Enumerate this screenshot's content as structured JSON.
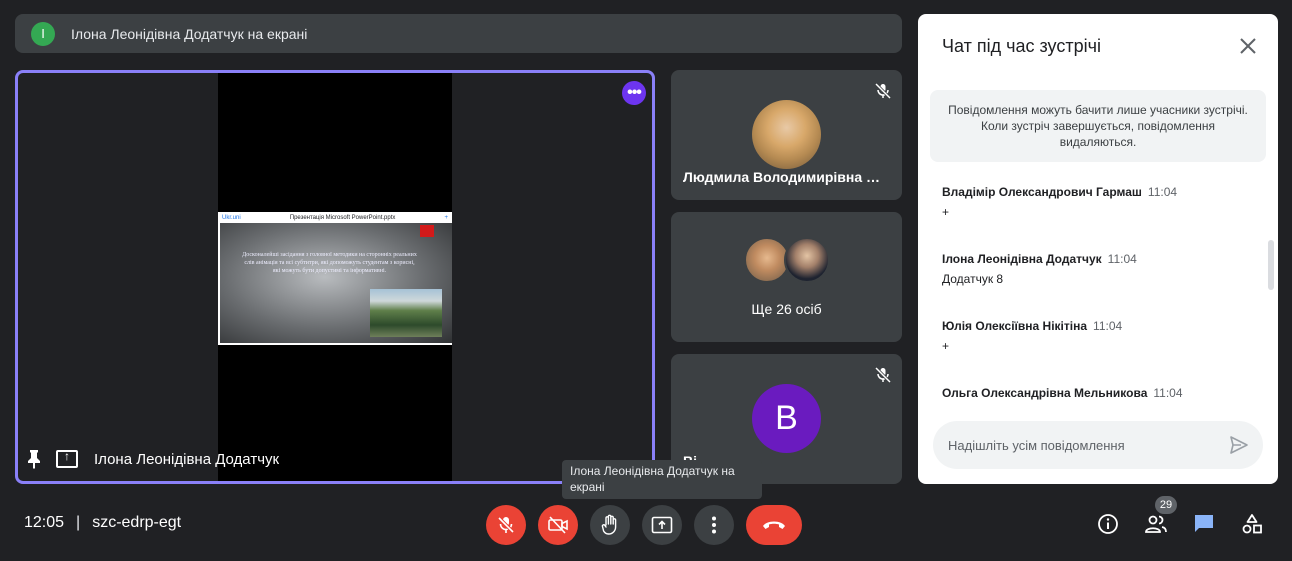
{
  "banner": {
    "avatar_letter": "І",
    "text": "Ілона Леонідівна Додатчук на екрані",
    "avatar_color": "#34a853"
  },
  "main_tile": {
    "presenter_name": "Ілона Леонідівна Додатчук",
    "slide": {
      "window_title": "Презентація Microsoft PowerPoint.pptx",
      "left_label": "Ukr.uni",
      "right_label": "+",
      "text": "Досконалейші засідання з головної методики на сторонніх реальних слів анімація та всі субтитри, які допоможуть студентам з корисні, які можуть бути допустимі та інформативні."
    },
    "accent_color": "#8a80f8"
  },
  "side_tiles": [
    {
      "name": "Людмила Володимирівна Б…",
      "muted": true
    },
    {
      "more_label": "Ще 26 осіб"
    },
    {
      "avatar_letter": "В",
      "name": "Ві…",
      "muted": true,
      "avatar_color": "#6a1bbf"
    }
  ],
  "tooltip": "Ілона Леонідівна Додатчук на екрані",
  "chat": {
    "title": "Чат під час зустрічі",
    "notice": "Повідомлення можуть бачити лише учасники зустрічі. Коли зустріч завершується, повідомлення видаляються.",
    "messages": [
      {
        "author": "Владімір Олександрович Гармаш",
        "time": "11:04",
        "text": "+"
      },
      {
        "author": "Ілона Леонідівна Додатчук",
        "time": "11:04",
        "text": "Додатчук 8"
      },
      {
        "author": "Юлія Олексіївна Нікітіна",
        "time": "11:04",
        "text": "+"
      },
      {
        "author": "Ольга Олександрівна Мельникова",
        "time": "11:04",
        "text": ""
      }
    ],
    "input_placeholder": "Надішліть усім повідомлення"
  },
  "bottom_bar": {
    "time": "12:05",
    "separator": "|",
    "meeting_code": "szc-edrp-egt",
    "people_count": "29"
  },
  "colors": {
    "danger": "#ea4335",
    "control_gray": "#3c4043",
    "chat_active": "#8ab4f8"
  }
}
